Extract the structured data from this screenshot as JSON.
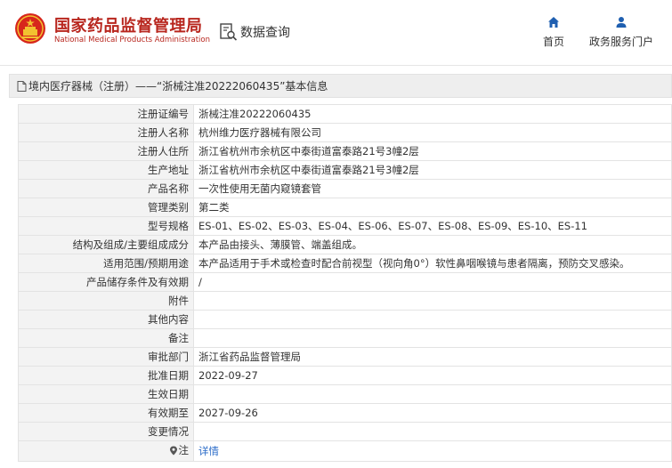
{
  "header": {
    "title": "国家药品监督管理局",
    "subtitle": "National Medical Products Administration",
    "query_label": "数据查询",
    "nav": [
      {
        "label": "首页",
        "icon": "home-icon"
      },
      {
        "label": "政务服务门户",
        "icon": "user-icon"
      }
    ]
  },
  "breadcrumb": {
    "text": "境内医疗器械（注册）——“浙械注准20222060435”基本信息"
  },
  "rows": [
    {
      "label": "注册证编号",
      "value": "浙械注准20222060435"
    },
    {
      "label": "注册人名称",
      "value": "杭州维力医疗器械有限公司"
    },
    {
      "label": "注册人住所",
      "value": "浙江省杭州市余杭区中泰街道富泰路21号3幢2层"
    },
    {
      "label": "生产地址",
      "value": "浙江省杭州市余杭区中泰街道富泰路21号3幢2层"
    },
    {
      "label": "产品名称",
      "value": "一次性使用无菌内窥镜套管"
    },
    {
      "label": "管理类别",
      "value": "第二类"
    },
    {
      "label": "型号规格",
      "value": "ES-01、ES-02、ES-03、ES-04、ES-06、ES-07、ES-08、ES-09、ES-10、ES-11"
    },
    {
      "label": "结构及组成/主要组成成分",
      "value": "本产品由接头、薄膜管、端盖组成。"
    },
    {
      "label": "适用范围/预期用途",
      "value": "本产品适用于手术或检查时配合前视型（视向角0°）软性鼻咽喉镜与患者隔离，预防交叉感染。"
    },
    {
      "label": "产品储存条件及有效期",
      "value": "/"
    },
    {
      "label": "附件",
      "value": ""
    },
    {
      "label": "其他内容",
      "value": ""
    },
    {
      "label": "备注",
      "value": ""
    },
    {
      "label": "审批部门",
      "value": "浙江省药品监督管理局"
    },
    {
      "label": "批准日期",
      "value": "2022-09-27"
    },
    {
      "label": "生效日期",
      "value": ""
    },
    {
      "label": "有效期至",
      "value": "2027-09-26"
    },
    {
      "label": "变更情况",
      "value": ""
    }
  ],
  "note_row": {
    "label": "注",
    "link": "详情"
  },
  "colors": {
    "brand_red": "#b8261e",
    "nav_blue": "#1f5fb0",
    "link_blue": "#2a6bc8"
  }
}
